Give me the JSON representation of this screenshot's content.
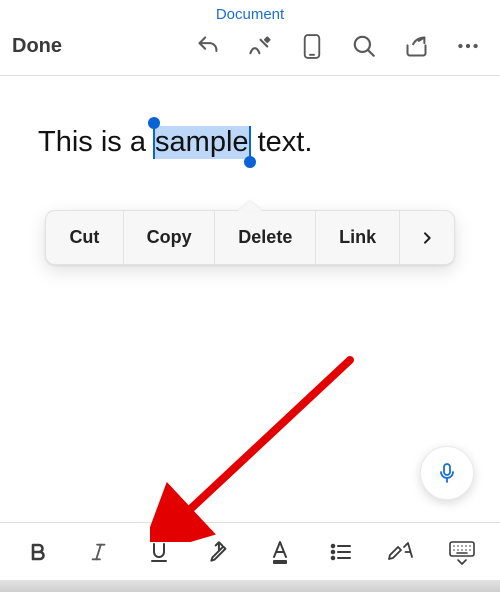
{
  "header": {
    "title": "Document",
    "done_label": "Done"
  },
  "editor": {
    "text_before": "This is a ",
    "selected_text": "sample",
    "text_after": " text."
  },
  "context_menu": {
    "items": [
      "Cut",
      "Copy",
      "Delete",
      "Link"
    ]
  },
  "colors": {
    "accent": "#1a6fd6",
    "selection": "#bcd7f7",
    "annotation": "#e30000"
  },
  "icons": {
    "top": [
      "undo",
      "draw",
      "phone",
      "search",
      "share",
      "more"
    ],
    "bottom": [
      "bold",
      "italic",
      "underline",
      "highlighter",
      "font-color",
      "bullet-list",
      "styles-format",
      "keyboard-hide"
    ]
  }
}
